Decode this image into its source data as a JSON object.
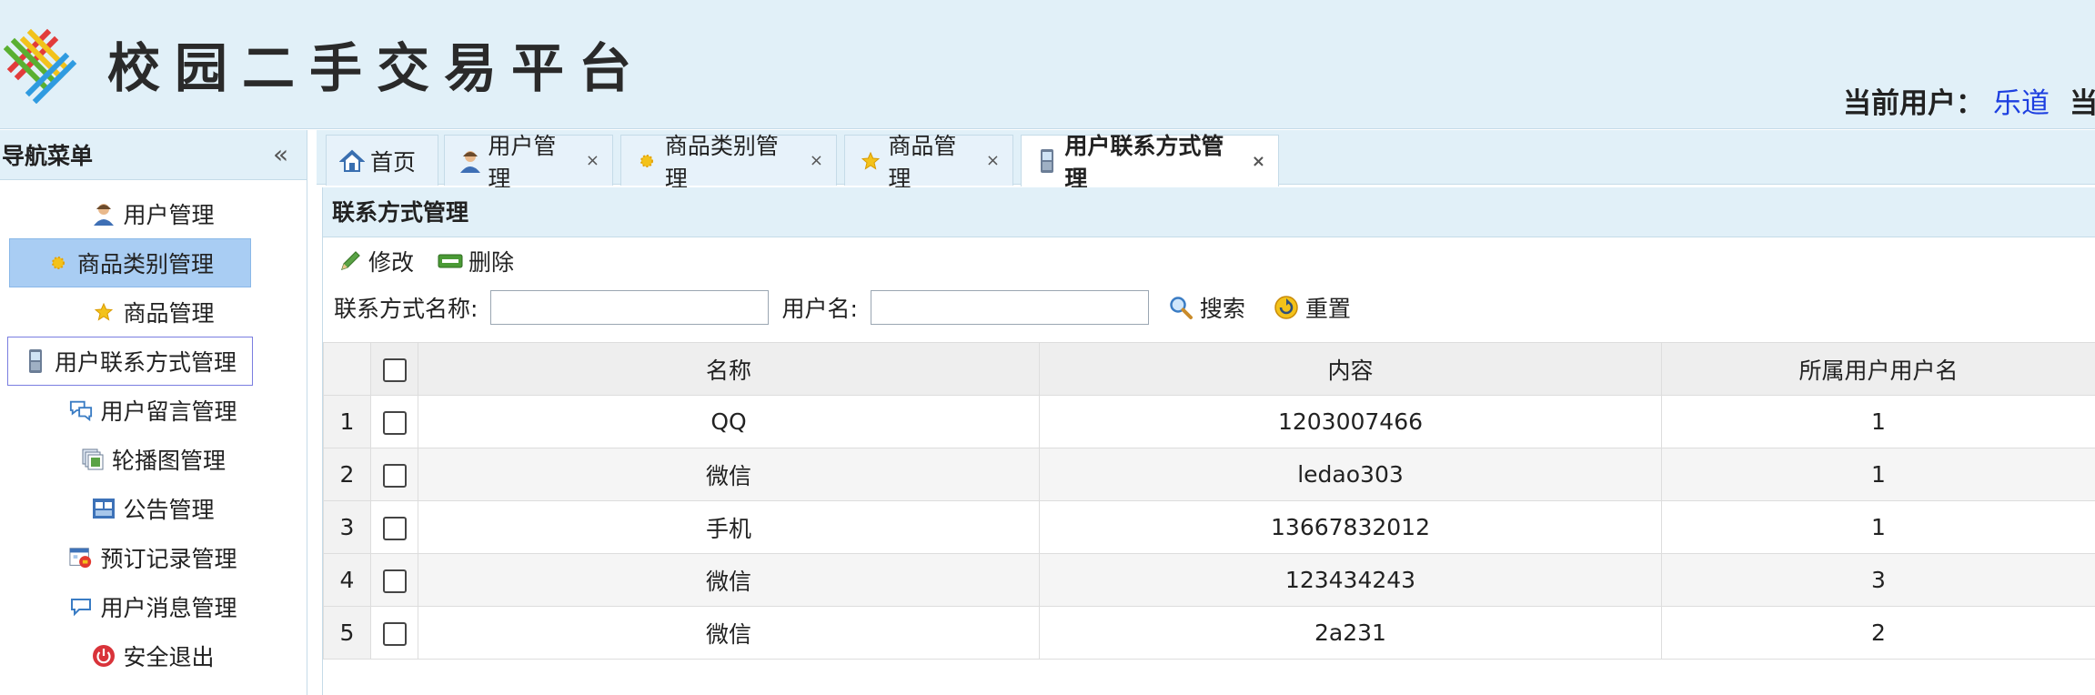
{
  "header": {
    "site_title": "校园二手交易平台",
    "current_user_label": "当前用户：",
    "current_user_name": "乐道",
    "trailing_text": "当"
  },
  "sidebar": {
    "title": "导航菜单",
    "collapse_symbol": "«",
    "items": [
      {
        "label": "用户管理",
        "icon": "user-icon"
      },
      {
        "label": "商品类别管理",
        "icon": "sun-icon",
        "selected": true
      },
      {
        "label": "商品管理",
        "icon": "star-icon"
      },
      {
        "label": "用户联系方式管理",
        "icon": "phone-icon"
      },
      {
        "label": "用户留言管理",
        "icon": "chat-icon"
      },
      {
        "label": "轮播图管理",
        "icon": "images-icon"
      },
      {
        "label": "公告管理",
        "icon": "board-icon"
      },
      {
        "label": "预订记录管理",
        "icon": "calendar-icon"
      },
      {
        "label": "用户消息管理",
        "icon": "message-icon"
      },
      {
        "label": "安全退出",
        "icon": "power-icon"
      }
    ]
  },
  "tabs": [
    {
      "label": "首页",
      "icon": "home-icon",
      "closable": false
    },
    {
      "label": "用户管理",
      "icon": "user-icon",
      "closable": true
    },
    {
      "label": "商品类别管理",
      "icon": "sun-icon",
      "closable": true
    },
    {
      "label": "商品管理",
      "icon": "star-icon",
      "closable": true
    },
    {
      "label": "用户联系方式管理",
      "icon": "phone-icon",
      "closable": true,
      "active": true
    }
  ],
  "tab_close_symbol": "×",
  "panel": {
    "title": "联系方式管理",
    "toolbar": {
      "edit_label": "修改",
      "delete_label": "删除"
    },
    "search": {
      "contact_name_label": "联系方式名称:",
      "contact_name_value": "",
      "username_label": "用户名:",
      "username_value": "",
      "search_label": "搜索",
      "reset_label": "重置"
    },
    "grid": {
      "columns": [
        "名称",
        "内容",
        "所属用户用户名"
      ],
      "rows": [
        {
          "no": "1",
          "name": "QQ",
          "content": "1203007466",
          "owner": "1"
        },
        {
          "no": "2",
          "name": "微信",
          "content": "ledao303",
          "owner": "1"
        },
        {
          "no": "3",
          "name": "手机",
          "content": "13667832012",
          "owner": "1"
        },
        {
          "no": "4",
          "name": "微信",
          "content": "123434243",
          "owner": "3"
        },
        {
          "no": "5",
          "name": "微信",
          "content": "2a231",
          "owner": "2"
        }
      ]
    }
  },
  "colors": {
    "header_bg": "#e1f0f8",
    "selected_menu_bg": "#a9cdf3",
    "user_link": "#1d3fe0"
  }
}
